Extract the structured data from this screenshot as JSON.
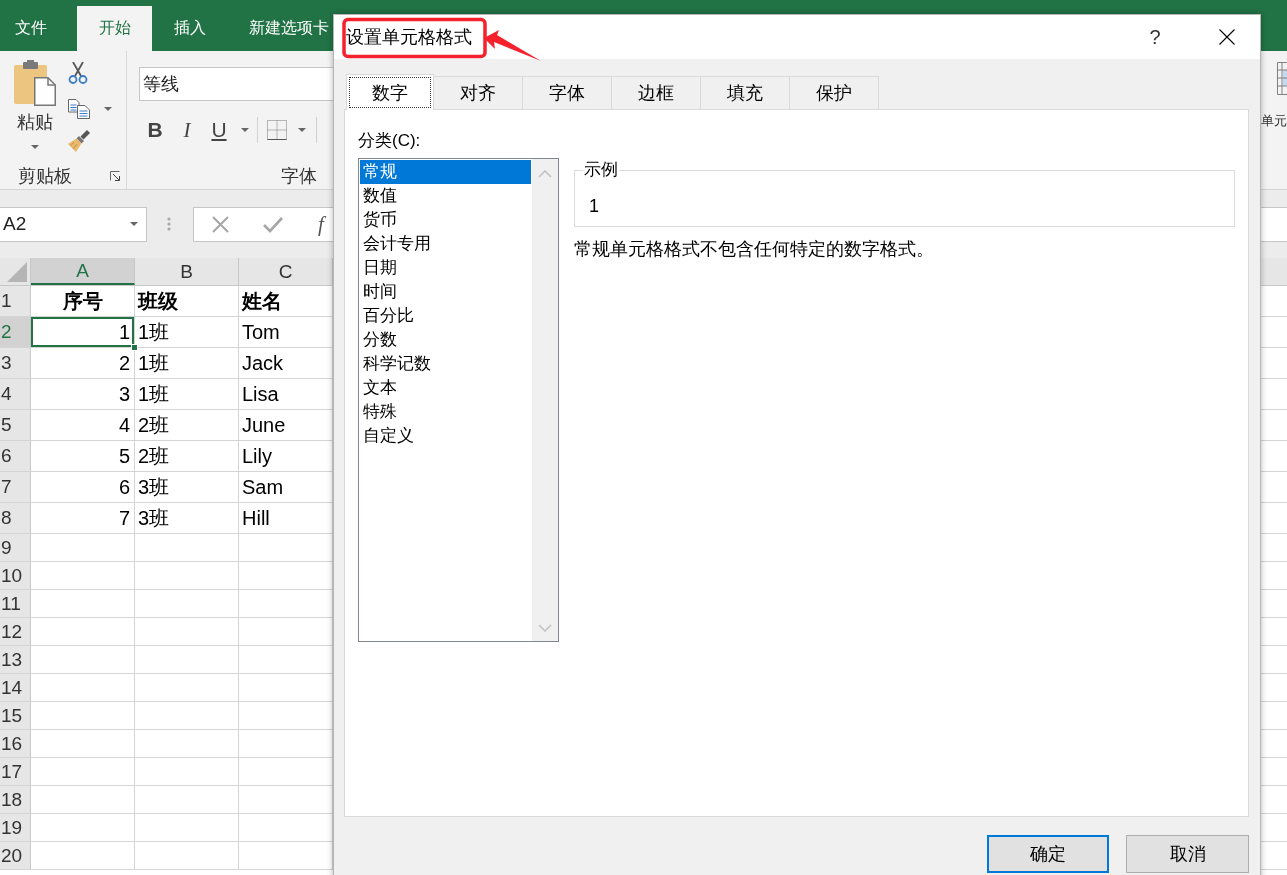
{
  "excel": {
    "ribbon_tabs": [
      {
        "label": "文件",
        "selected": false
      },
      {
        "label": "开始",
        "selected": true
      },
      {
        "label": "插入",
        "selected": false
      },
      {
        "label": "新建选项卡",
        "selected": false
      }
    ],
    "clipboard_group": {
      "paste_label": "粘贴",
      "group_label": "剪贴板"
    },
    "font_group": {
      "font_name": "等线",
      "format_buttons": [
        {
          "label": "B",
          "kind": "bold"
        },
        {
          "label": "I",
          "kind": "italic"
        },
        {
          "label": "U",
          "kind": "underline"
        }
      ],
      "group_label": "字体"
    },
    "cells_group": {
      "label": "单元"
    },
    "formula_bar": {
      "name_box": "A2",
      "function_button": "f"
    },
    "sheet": {
      "columns": [
        {
          "label": "A",
          "selected": true
        },
        {
          "label": "B",
          "selected": false
        },
        {
          "label": "C",
          "selected": false
        }
      ],
      "rows": [
        {
          "number": "1",
          "selected": false,
          "kind": "header",
          "cells": [
            "序号",
            "班级",
            "姓名"
          ]
        },
        {
          "number": "2",
          "selected": true,
          "kind": "data",
          "cells": [
            "1",
            "1班",
            "Tom"
          ]
        },
        {
          "number": "3",
          "selected": false,
          "kind": "data",
          "cells": [
            "2",
            "1班",
            "Jack"
          ]
        },
        {
          "number": "4",
          "selected": false,
          "kind": "data",
          "cells": [
            "3",
            "1班",
            "Lisa"
          ]
        },
        {
          "number": "5",
          "selected": false,
          "kind": "data",
          "cells": [
            "4",
            "2班",
            "June"
          ]
        },
        {
          "number": "6",
          "selected": false,
          "kind": "data",
          "cells": [
            "5",
            "2班",
            "Lily"
          ]
        },
        {
          "number": "7",
          "selected": false,
          "kind": "data",
          "cells": [
            "6",
            "3班",
            "Sam"
          ]
        },
        {
          "number": "8",
          "selected": false,
          "kind": "data",
          "cells": [
            "7",
            "3班",
            "Hill"
          ]
        },
        {
          "number": "9",
          "selected": false,
          "kind": "empty"
        },
        {
          "number": "10",
          "selected": false,
          "kind": "empty"
        },
        {
          "number": "11",
          "selected": false,
          "kind": "empty"
        },
        {
          "number": "12",
          "selected": false,
          "kind": "empty"
        },
        {
          "number": "13",
          "selected": false,
          "kind": "empty"
        },
        {
          "number": "14",
          "selected": false,
          "kind": "empty"
        },
        {
          "number": "15",
          "selected": false,
          "kind": "empty"
        },
        {
          "number": "16",
          "selected": false,
          "kind": "empty"
        },
        {
          "number": "17",
          "selected": false,
          "kind": "empty"
        },
        {
          "number": "18",
          "selected": false,
          "kind": "empty"
        },
        {
          "number": "19",
          "selected": false,
          "kind": "empty"
        },
        {
          "number": "20",
          "selected": false,
          "kind": "empty"
        }
      ]
    }
  },
  "dialog": {
    "title": "设置单元格格式",
    "help": "?",
    "tabs": [
      {
        "label": "数字",
        "selected": true
      },
      {
        "label": "对齐",
        "selected": false
      },
      {
        "label": "字体",
        "selected": false
      },
      {
        "label": "边框",
        "selected": false
      },
      {
        "label": "填充",
        "selected": false
      },
      {
        "label": "保护",
        "selected": false
      }
    ],
    "category_label": "分类(C):",
    "categories": [
      {
        "label": "常规",
        "selected": true
      },
      {
        "label": "数值",
        "selected": false
      },
      {
        "label": "货币",
        "selected": false
      },
      {
        "label": "会计专用",
        "selected": false
      },
      {
        "label": "日期",
        "selected": false
      },
      {
        "label": "时间",
        "selected": false
      },
      {
        "label": "百分比",
        "selected": false
      },
      {
        "label": "分数",
        "selected": false
      },
      {
        "label": "科学记数",
        "selected": false
      },
      {
        "label": "文本",
        "selected": false
      },
      {
        "label": "特殊",
        "selected": false
      },
      {
        "label": "自定义",
        "selected": false
      }
    ],
    "sample": {
      "legend": "示例",
      "value": "1"
    },
    "description": "常规单元格格式不包含任何特定的数字格式。",
    "buttons": [
      {
        "label": "确定",
        "kind": "default"
      },
      {
        "label": "取消",
        "kind": "normal"
      }
    ]
  }
}
